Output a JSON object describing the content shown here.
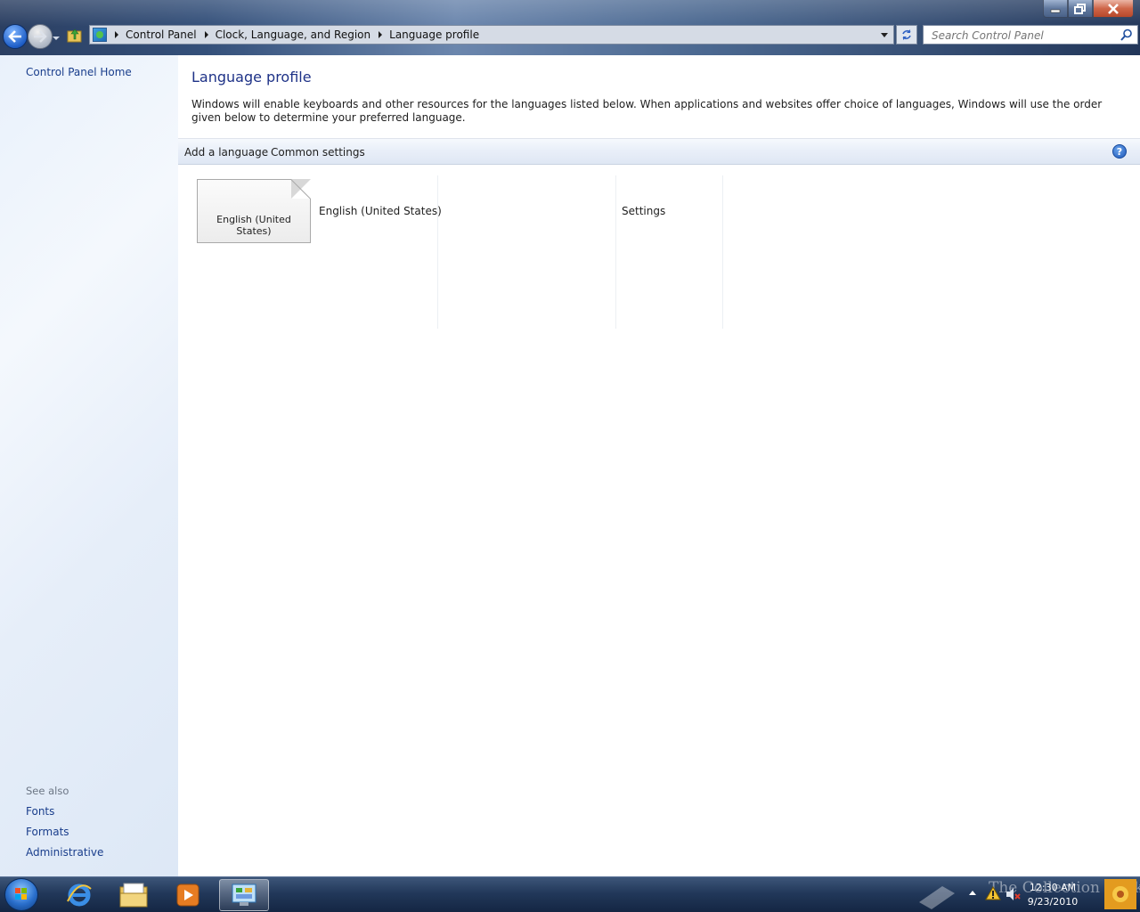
{
  "window": {
    "controls": {
      "minimize_icon": "minimize-icon",
      "restore_icon": "restore-icon",
      "close_icon": "close-icon"
    }
  },
  "nav": {
    "breadcrumb": [
      "Control Panel",
      "Clock, Language, and Region",
      "Language profile"
    ],
    "search": {
      "placeholder": "Search Control Panel",
      "value": ""
    }
  },
  "sidebar": {
    "home_link": "Control Panel Home",
    "see_also_title": "See also",
    "see_also_links": [
      "Fonts",
      "Formats",
      "Administrative"
    ]
  },
  "main": {
    "title": "Language profile",
    "description": "Windows will enable keyboards and other resources for the languages listed below. When applications and websites offer choice of languages, Windows will use the order given below to determine your preferred language.",
    "toolbar": {
      "add_language": "Add a language",
      "common_settings": "Common settings",
      "help_glyph": "?"
    },
    "languages": [
      {
        "tile_label": "English (United States)",
        "name": "English (United States)",
        "settings_label": "Settings"
      }
    ]
  },
  "taskbar": {
    "apps": [
      "internet-explorer-icon",
      "windows-explorer-icon",
      "media-player-icon",
      "control-panel-icon"
    ],
    "watermark": "The Collection Book",
    "clock": {
      "time": "12:30 AM",
      "date": "9/23/2010"
    }
  },
  "colors": {
    "link": "#1a3e8c",
    "title": "#1e3287",
    "accent": "#1f58b8"
  }
}
